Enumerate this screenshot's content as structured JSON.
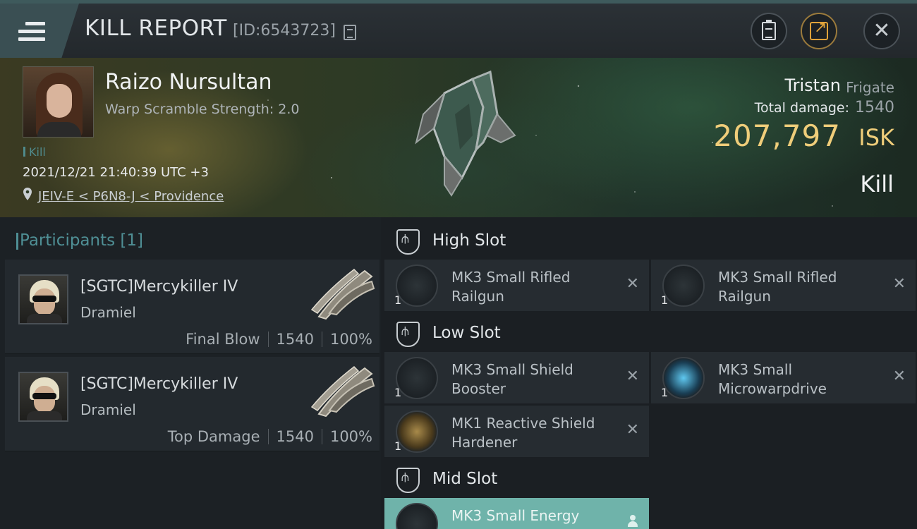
{
  "header": {
    "title": "KILL REPORT",
    "report_id": "[ID:6543723]"
  },
  "victim": {
    "name": "Raizo Nursultan",
    "subtitle": "Warp Scramble Strength: 2.0",
    "tag": "Kill",
    "timestamp": "2021/12/21 21:40:39 UTC +3",
    "location": "JEIV-E < P6N8-J < Providence",
    "ship_name": "Tristan",
    "ship_class": "Frigate",
    "damage_label": "Total damage:",
    "damage_value": "1540",
    "isk_value": "207,797",
    "isk_unit": "ISK",
    "result": "Kill"
  },
  "participants": {
    "title": "Participants [1]",
    "rows": [
      {
        "name": "[SGTC]Mercykiller IV",
        "ship": "Dramiel",
        "role": "Final Blow",
        "damage": "1540",
        "percent": "100%"
      },
      {
        "name": "[SGTC]Mercykiller IV",
        "ship": "Dramiel",
        "role": "Top Damage",
        "damage": "1540",
        "percent": "100%"
      }
    ]
  },
  "slots": {
    "high": {
      "label": "High Slot",
      "items": [
        {
          "line1": "MK3 Small Rifled",
          "line2": "Railgun",
          "qty": "1"
        },
        {
          "line1": "MK3 Small Rifled",
          "line2": "Railgun",
          "qty": "1"
        }
      ]
    },
    "low": {
      "label": "Low Slot",
      "items": [
        {
          "line1": "MK3 Small Shield",
          "line2": "Booster",
          "qty": "1"
        },
        {
          "line1": "MK3 Small",
          "line2": "Microwarpdrive",
          "qty": "1"
        },
        {
          "line1": "MK1 Reactive Shield",
          "line2": "Hardener",
          "qty": "1"
        }
      ]
    },
    "mid": {
      "label": "Mid Slot",
      "items": [
        {
          "line1": "MK3 Small Energy",
          "line2": "",
          "qty": ""
        }
      ]
    }
  },
  "icons": {
    "menu": "hamburger-icon",
    "copy": "copy-icon",
    "clipboard": "clipboard-icon",
    "share": "share-icon",
    "close": "close-icon",
    "location": "map-pin-icon",
    "slot": "slot-shield-icon",
    "remove": "close-x-icon"
  },
  "colors": {
    "accent_teal": "#4f8f95",
    "isk_gold": "#efcd7a",
    "share_orange": "#e0a33a",
    "highlight_row": "#6fb3aa"
  }
}
